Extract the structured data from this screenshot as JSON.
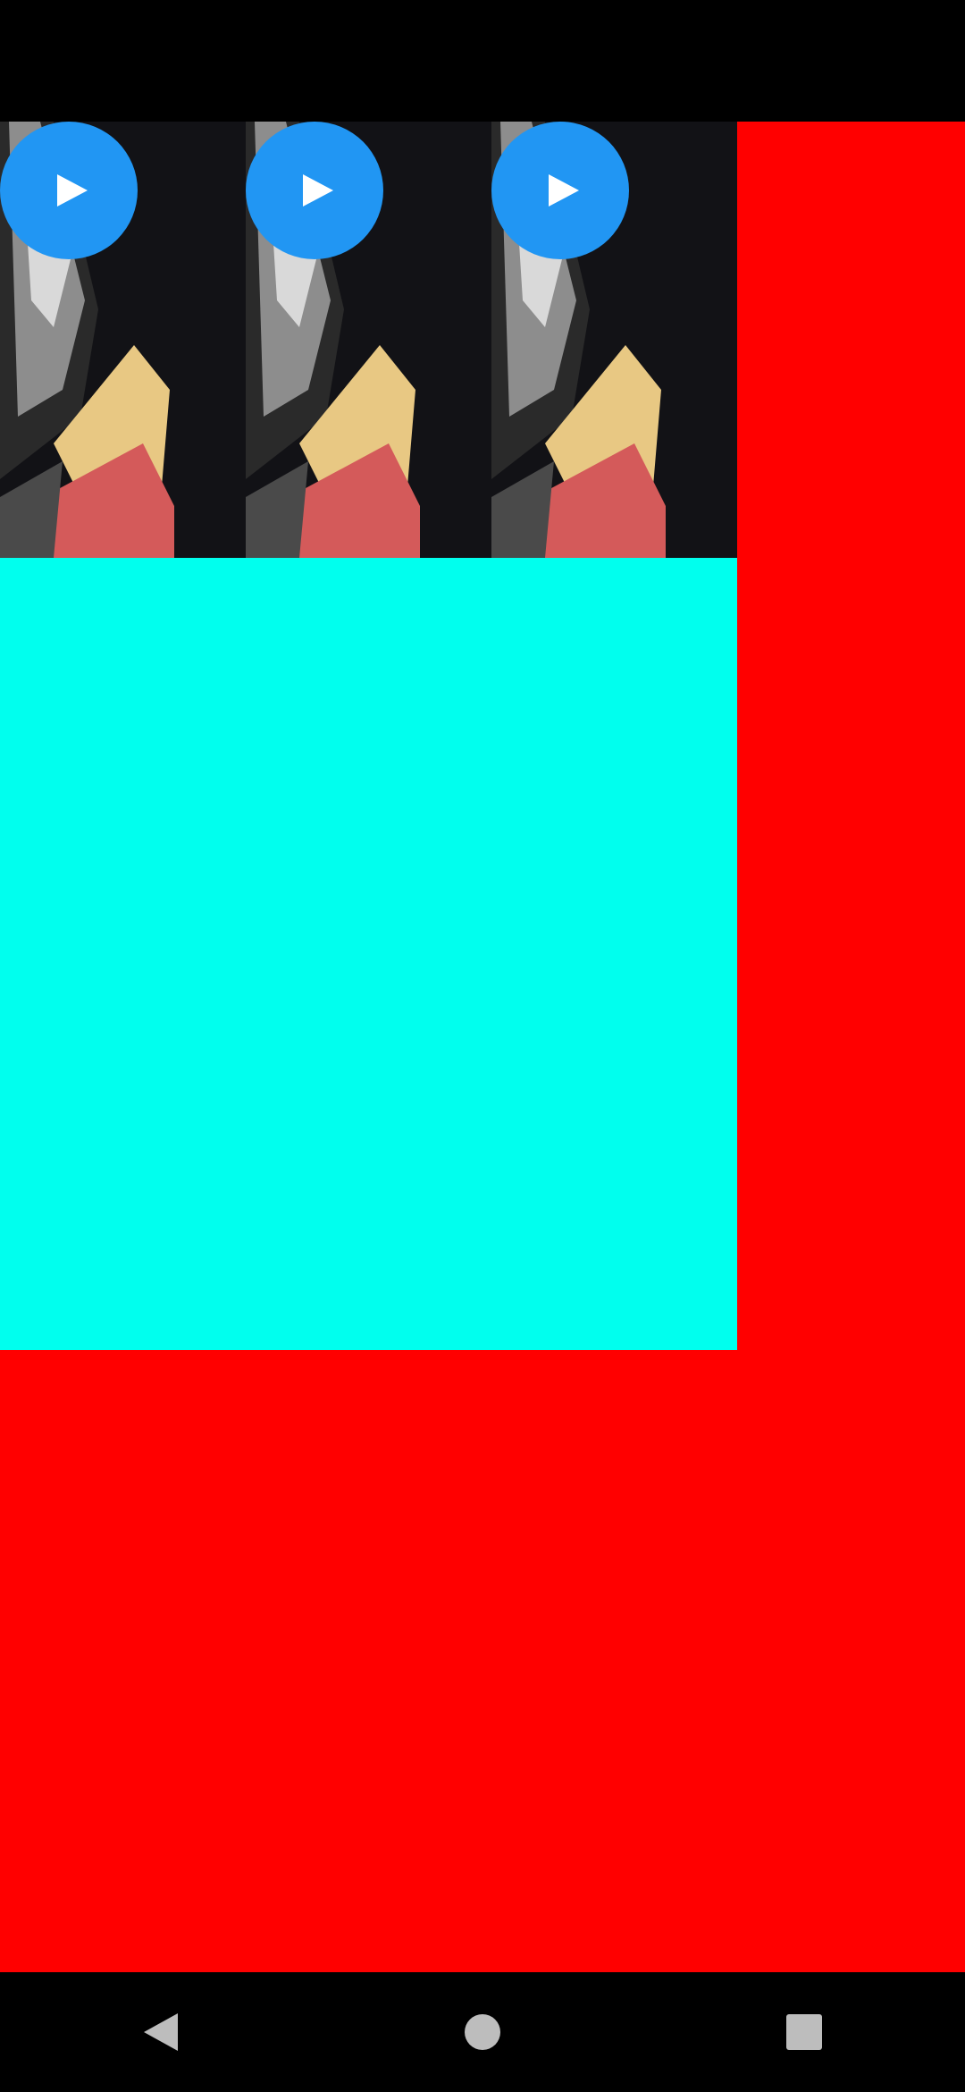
{
  "colors": {
    "status_bar": "#000000",
    "background": "#ff0000",
    "panel": "#00ffee",
    "play_button": "#2196f3",
    "nav_bar": "#000000",
    "nav_icon": "#bdbdbd"
  },
  "videos": [
    {
      "thumbnail": "video-thumbnail",
      "action_icon": "play-icon"
    },
    {
      "thumbnail": "video-thumbnail",
      "action_icon": "play-icon"
    },
    {
      "thumbnail": "video-thumbnail",
      "action_icon": "play-icon"
    }
  ],
  "nav": {
    "back_icon": "back-triangle-icon",
    "home_icon": "home-circle-icon",
    "recents_icon": "recents-square-icon"
  }
}
